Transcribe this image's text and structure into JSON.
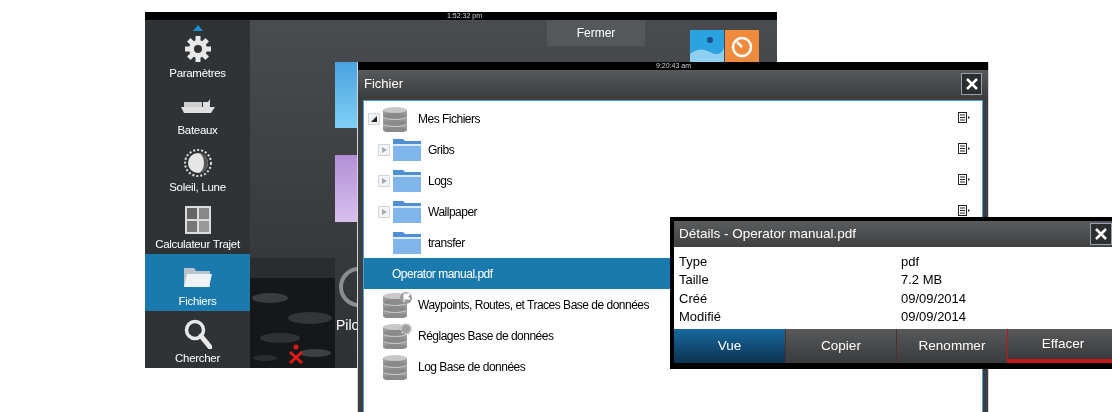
{
  "background_screen": {
    "clock": "1:52:32 pm",
    "close_button": "Fermer",
    "partial_label": "Pilo",
    "sidebar": {
      "items": [
        {
          "label": "Paramètres",
          "kind": "settings",
          "selected": false
        },
        {
          "label": "Bateaux",
          "kind": "vessels",
          "selected": false
        },
        {
          "label": "Soleil, Lune",
          "kind": "sunmoon",
          "selected": false
        },
        {
          "label": "Calculateur Trajet",
          "kind": "calculator",
          "selected": false
        },
        {
          "label": "Fichiers",
          "kind": "files",
          "selected": true
        },
        {
          "label": "Chercher",
          "kind": "search",
          "selected": false
        }
      ]
    }
  },
  "file_window": {
    "clock": "9:20:43 am",
    "title": "Fichier",
    "tree": [
      {
        "label": "Mes Fichiers",
        "kind": "database",
        "expanded": true,
        "has_menu": true,
        "selected": false,
        "children": [
          {
            "label": "Gribs",
            "kind": "folder",
            "expanded": false,
            "has_menu": true,
            "selected": false
          },
          {
            "label": "Logs",
            "kind": "folder",
            "expanded": false,
            "has_menu": true,
            "selected": false
          },
          {
            "label": "Wallpaper",
            "kind": "folder",
            "expanded": false,
            "has_menu": true,
            "selected": false
          },
          {
            "label": "transfer",
            "kind": "folder",
            "has_menu": false,
            "selected": false
          },
          {
            "label": "Operator manual.pdf",
            "kind": "file",
            "has_menu": false,
            "selected": true
          }
        ]
      },
      {
        "label": "Waypoints, Routes, et Traces Base de données",
        "kind": "waypointdb",
        "has_menu": false,
        "selected": false
      },
      {
        "label": "Réglages Base de données",
        "kind": "settingsdb",
        "has_menu": false,
        "selected": false
      },
      {
        "label": "Log Base de données",
        "kind": "database",
        "has_menu": false,
        "selected": false
      }
    ]
  },
  "details_dialog": {
    "title": "Détails - Operator manual.pdf",
    "properties": [
      {
        "name": "Type",
        "value": "pdf"
      },
      {
        "name": "Taille",
        "value": "7.2 MB"
      },
      {
        "name": "Créé",
        "value": "09/09/2014"
      },
      {
        "name": "Modifié",
        "value": "09/09/2014"
      }
    ],
    "buttons": [
      {
        "label": "Vue",
        "kind": "normal",
        "selected": true
      },
      {
        "label": "Copier",
        "kind": "normal",
        "selected": false
      },
      {
        "label": "Renommer",
        "kind": "normal",
        "selected": false
      },
      {
        "label": "Effacer",
        "kind": "danger",
        "selected": false
      }
    ]
  }
}
